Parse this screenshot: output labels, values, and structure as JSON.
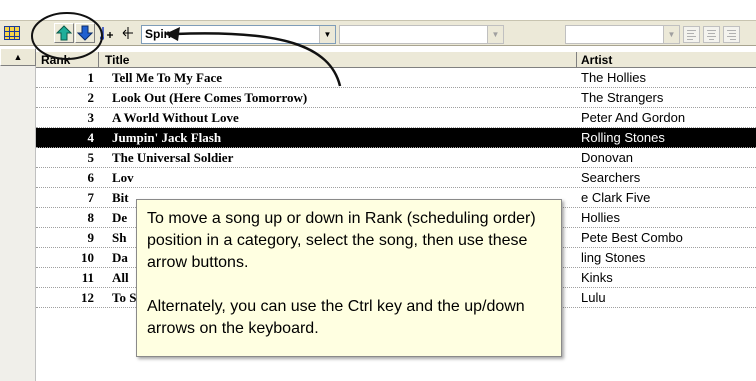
{
  "toolbar": {
    "category_select": "Spins",
    "second_select": "",
    "third_select": ""
  },
  "columns": {
    "rank": "Rank",
    "title": "Title",
    "artist": "Artist"
  },
  "rows": [
    {
      "rank": "1",
      "title": "Tell Me To My Face",
      "artist": "The Hollies"
    },
    {
      "rank": "2",
      "title": "Look Out (Here Comes Tomorrow)",
      "artist": "The Strangers"
    },
    {
      "rank": "3",
      "title": "A World Without Love",
      "artist": "Peter And Gordon"
    },
    {
      "rank": "4",
      "title": "Jumpin' Jack Flash",
      "artist": "Rolling Stones",
      "selected": true
    },
    {
      "rank": "5",
      "title": "The Universal Soldier",
      "artist": "Donovan"
    },
    {
      "rank": "6",
      "title": "Lov",
      "artist": "Searchers"
    },
    {
      "rank": "7",
      "title": "Bit",
      "artist": "e Clark Five"
    },
    {
      "rank": "8",
      "title": "De",
      "artist": "Hollies"
    },
    {
      "rank": "9",
      "title": "Sh",
      "artist": "Pete Best Combo"
    },
    {
      "rank": "10",
      "title": "Da",
      "artist": "ling Stones"
    },
    {
      "rank": "11",
      "title": "All",
      "artist": "Kinks"
    },
    {
      "rank": "12",
      "title": "To Sir With Love",
      "artist": "Lulu"
    }
  ],
  "tooltip": {
    "line1": "To move a song up or down in Rank (scheduling order) position in a category, select the song, then use these arrow buttons.",
    "line2": "Alternately, you can use the Ctrl key and the up/down arrows on the keyboard."
  },
  "colors": {
    "arrow_up": "#1fae9a",
    "arrow_down": "#2060d0",
    "tooltip_bg": "#ffffe1",
    "selected_row": "#000000"
  },
  "icons": [
    "grid-icon",
    "move-up-icon",
    "move-down-icon",
    "sort-ascending-icon",
    "field-selector-icon"
  ]
}
